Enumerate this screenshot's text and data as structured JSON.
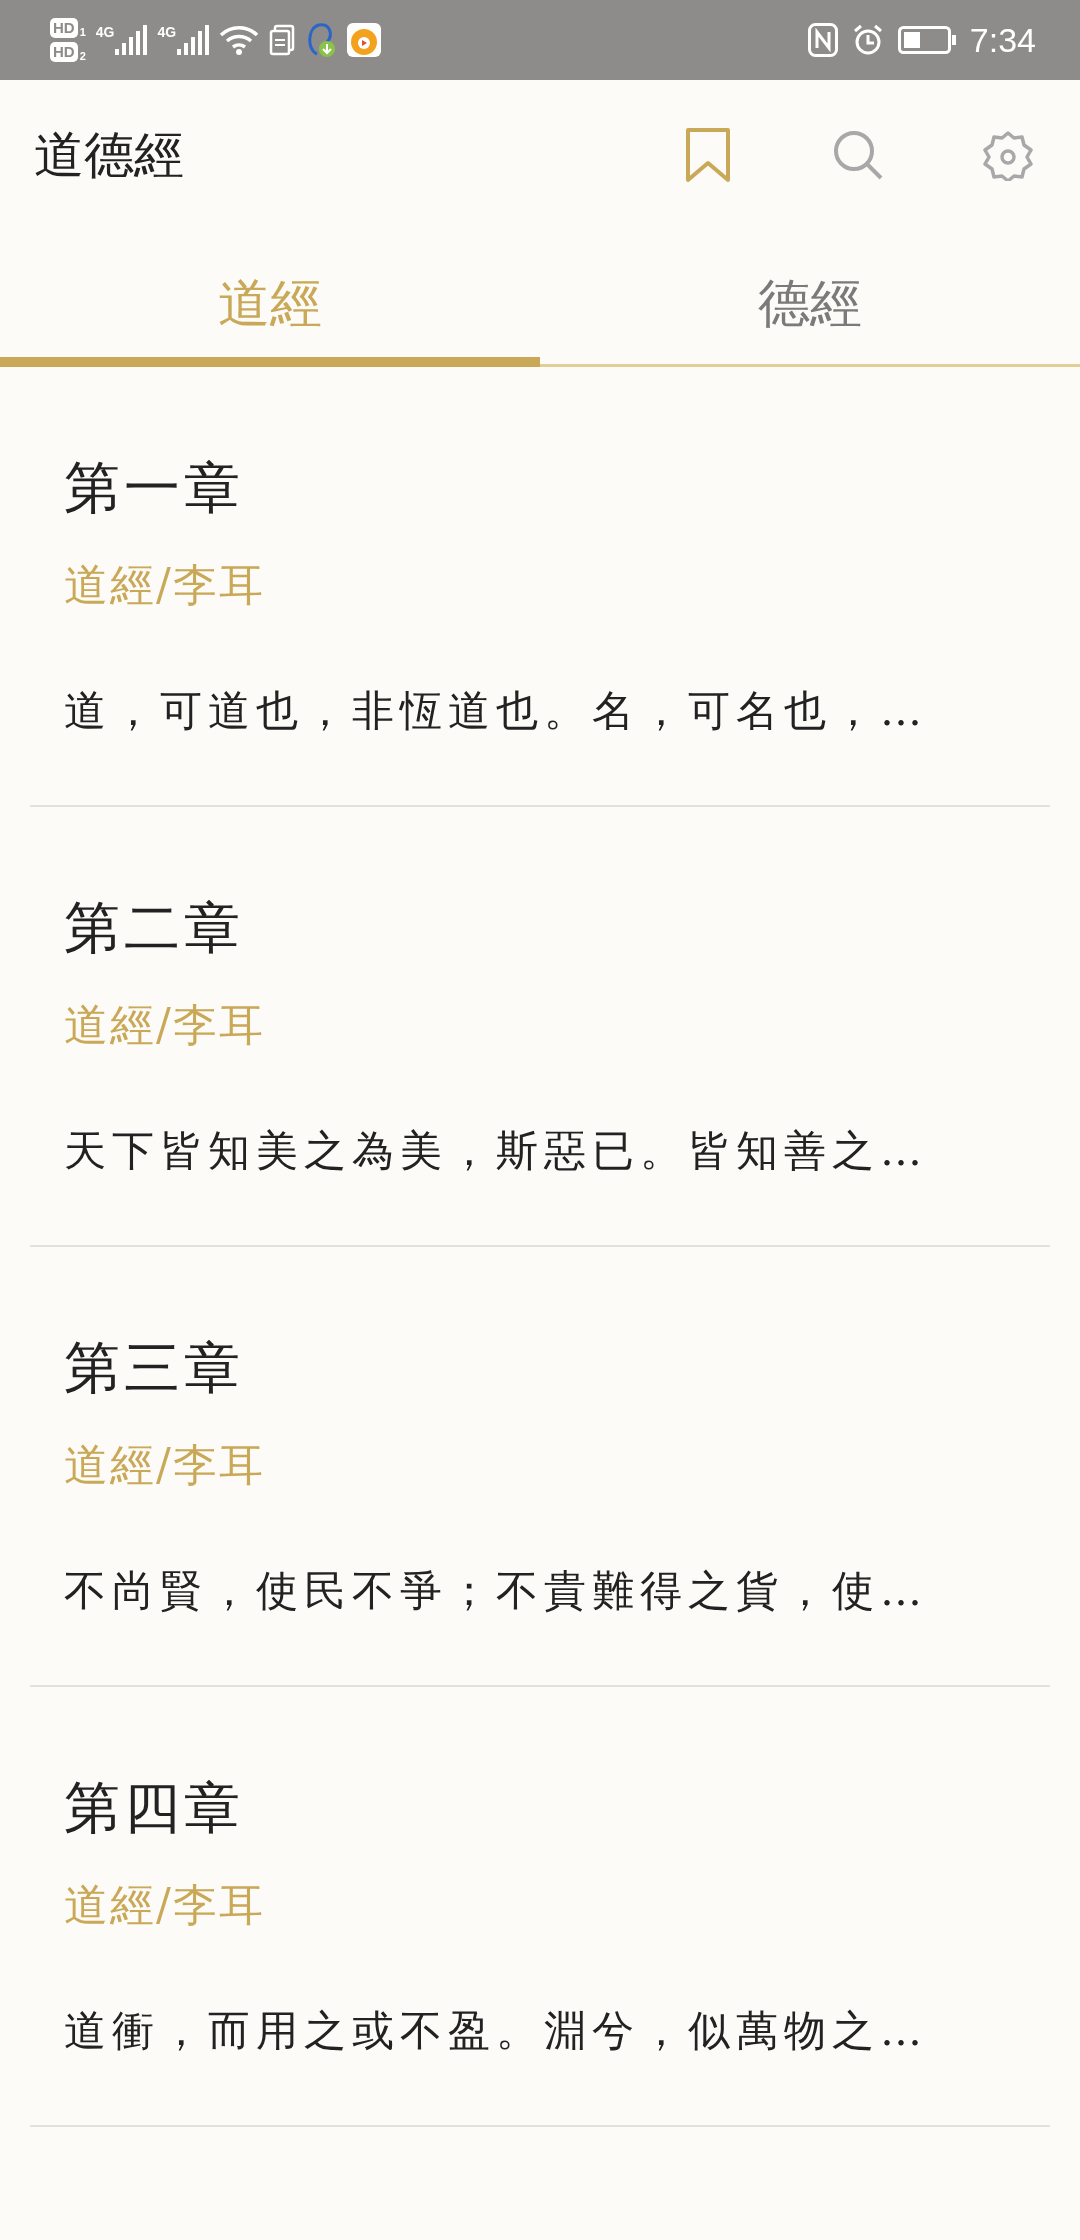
{
  "status_bar": {
    "sims": [
      {
        "label": "HD",
        "index": "1"
      },
      {
        "label": "HD",
        "index": "2"
      }
    ],
    "networks": [
      "4G",
      "4G"
    ],
    "time": "7:34"
  },
  "app_bar": {
    "title": "道德經"
  },
  "tabs": [
    {
      "label": "道經",
      "selected": true
    },
    {
      "label": "德經",
      "selected": false
    }
  ],
  "chapters": [
    {
      "title": "第一章",
      "source": "道經/李耳",
      "excerpt": "道，可道也，非恆道也。名，可名也，…"
    },
    {
      "title": "第二章",
      "source": "道經/李耳",
      "excerpt": "天下皆知美之為美，斯惡已。皆知善之…"
    },
    {
      "title": "第三章",
      "source": "道經/李耳",
      "excerpt": "不尚賢，使民不爭；不貴難得之貨，使…"
    },
    {
      "title": "第四章",
      "source": "道經/李耳",
      "excerpt": "道衝，而用之或不盈。淵兮，似萬物之…"
    }
  ]
}
